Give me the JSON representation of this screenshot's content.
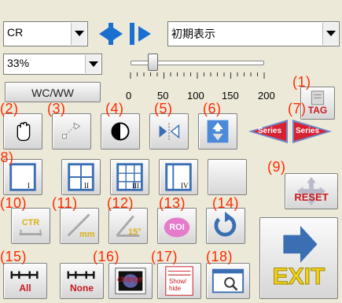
{
  "modality_select": {
    "value": "CR"
  },
  "preset_select": {
    "value": "初期表示"
  },
  "zoom_select": {
    "value": "33%"
  },
  "wcww_button": {
    "label": "WC/WW"
  },
  "slider": {
    "ticks": [
      "0",
      "50",
      "100",
      "150",
      "200"
    ],
    "value": 33
  },
  "tag_button": {
    "label": "TAG"
  },
  "series_buttons": {
    "prev_label": "Series",
    "next_label": "Series"
  },
  "layout_labels": [
    "I",
    "II",
    "III",
    "IV"
  ],
  "reset_button": {
    "label": "RESET"
  },
  "tool_labels": {
    "ctr": "CTR",
    "mm": "mm",
    "deg": "15°",
    "roi": "ROI"
  },
  "link_labels": {
    "all": "All",
    "none": "None",
    "change": "change",
    "showhide": "Show/ hide"
  },
  "exit_button": {
    "label": "EXIT"
  },
  "annotations": [
    "(1)",
    "(2)",
    "(3)",
    "(4)",
    "(5)",
    "(6)",
    "(7)",
    "(8)",
    "(9)",
    "(10)",
    "(11)",
    "(12)",
    "(13)",
    "(14)",
    "(15)",
    "(16)",
    "(17)",
    "(18)"
  ],
  "colors": {
    "annotation": "#ff2a00",
    "accent": "#1a6fd1",
    "exit": "#f2d21a"
  }
}
